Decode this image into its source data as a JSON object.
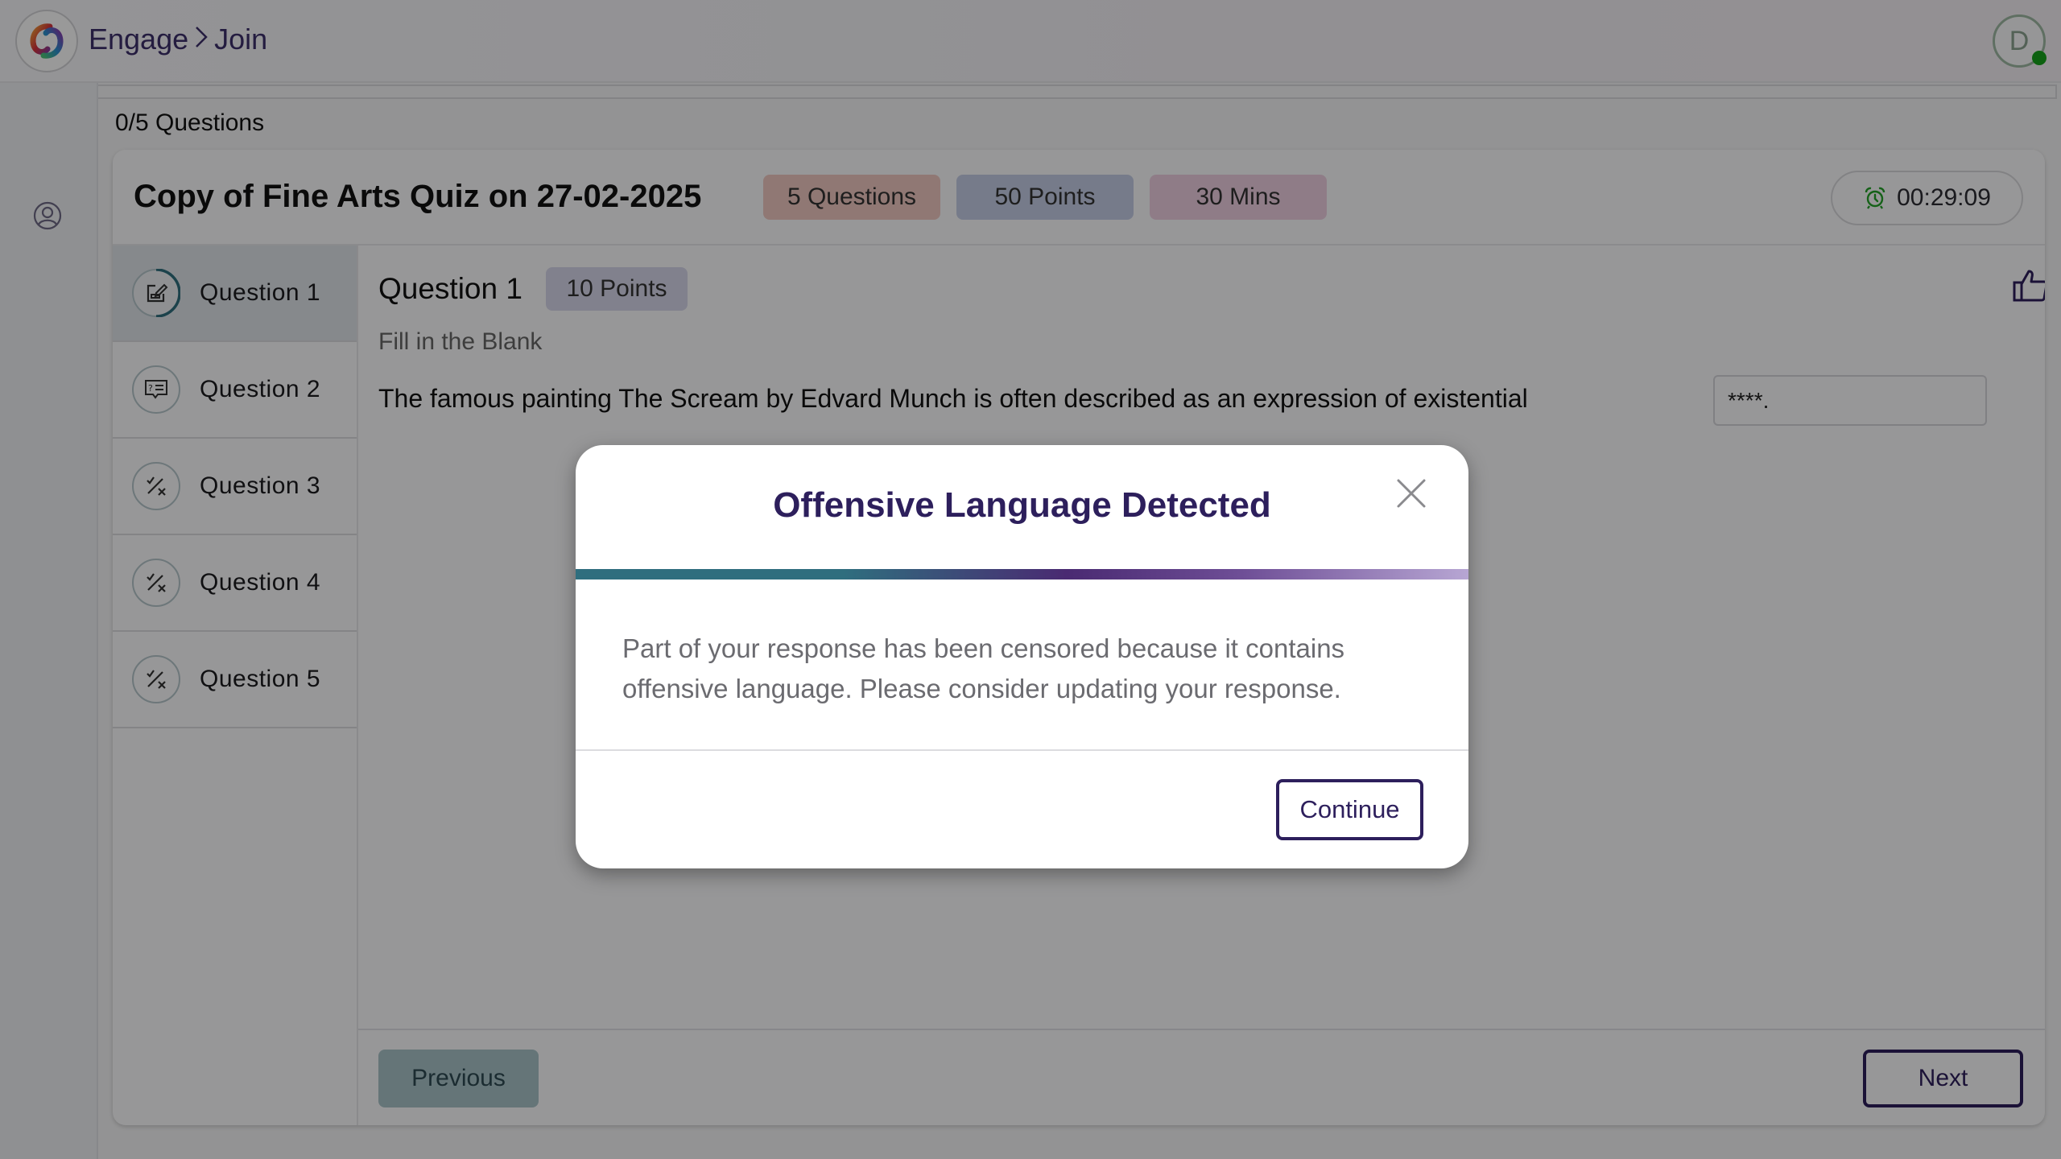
{
  "header": {
    "breadcrumb": [
      "Engage",
      "Join"
    ],
    "breadcrumb_separator": ">",
    "avatar_initial": "D",
    "avatar_status": "online",
    "colors": {
      "brand": "#2d1f5c",
      "online": "#15a21a"
    }
  },
  "rail": {
    "icons": [
      "user-circle-icon"
    ]
  },
  "progress": {
    "label": "0/5 Questions"
  },
  "quiz": {
    "title": "Copy of Fine Arts Quiz on 27-02-2025",
    "badges": [
      {
        "label": "5 Questions",
        "color": "#f1c8c1"
      },
      {
        "label": "50 Points",
        "color": "#c5cde6"
      },
      {
        "label": "30 Mins",
        "color": "#efcfe2"
      }
    ],
    "timer": {
      "icon": "alarm-clock-icon",
      "value": "00:29:09",
      "icon_color": "#23a228"
    }
  },
  "questions": [
    {
      "label": "Question 1",
      "icon": "fill-in-blank-icon",
      "active": true
    },
    {
      "label": "Question 2",
      "icon": "question-answer-icon",
      "active": false
    },
    {
      "label": "Question 3",
      "icon": "true-false-icon",
      "active": false
    },
    {
      "label": "Question 4",
      "icon": "true-false-icon",
      "active": false
    },
    {
      "label": "Question 5",
      "icon": "true-false-icon",
      "active": false
    }
  ],
  "current_question": {
    "title": "Question 1",
    "points": "10 Points",
    "type": "Fill in the Blank",
    "text": "The famous painting The Scream by Edvard Munch is often described as an expression of existential",
    "answer_value": "****."
  },
  "navigation": {
    "previous_label": "Previous",
    "next_label": "Next"
  },
  "modal": {
    "title": "Offensive Language Detected",
    "body": "Part of your response has been censored because it contains offensive language. Please consider updating your response.",
    "continue_label": "Continue",
    "close_icon": "close-icon"
  }
}
